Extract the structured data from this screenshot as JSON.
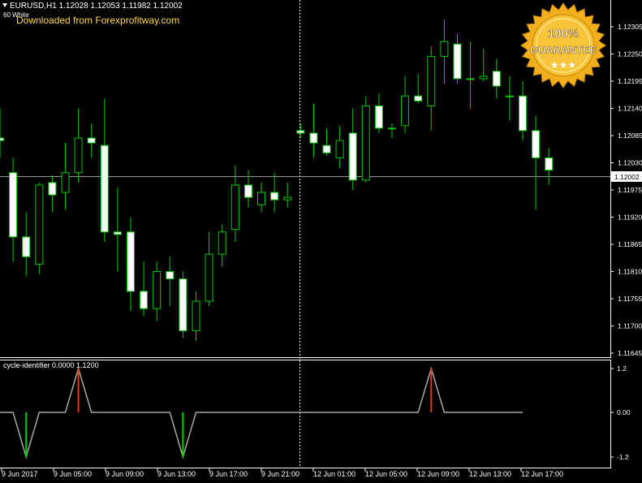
{
  "header": {
    "symbol_line": "EURUSD,H1  1.12028 1.12053 1.11982 1.12002",
    "template": "60 White",
    "download_note": "Downloaded from Forexprofitway.com"
  },
  "badge": {
    "line1": "100%",
    "line2": "GUARANTEE"
  },
  "colors": {
    "background": "#000000",
    "bull_wick": "#00c800",
    "bull_body": "#000000",
    "bear_body": "#ffffff",
    "axis": "#ffffff",
    "grid_line": "#9a9a9a",
    "indicator": "#a8a8a8",
    "peak_marker": "#d04020",
    "trough_marker": "#00d000",
    "badge_gold": "#f2b01e"
  },
  "price_axis": {
    "ticks": [
      "1.12305",
      "1.12250",
      "1.12195",
      "1.12140",
      "1.12085",
      "1.12030",
      "1.11975",
      "1.11920",
      "1.11865",
      "1.11810",
      "1.11755",
      "1.11700",
      "1.11645"
    ],
    "current_price": "1.12002"
  },
  "indicator": {
    "label": "cycle-identifier 0.0000 1.1200",
    "ticks": [
      "1.2",
      "0.00",
      "-1.2"
    ]
  },
  "time_axis": {
    "labels": [
      "9 Jun 2017",
      "9 Jun 05:00",
      "9 Jun 09:00",
      "9 Jun 13:00",
      "9 Jun 17:00",
      "9 Jun 21:00",
      "12 Jun 01:00",
      "12 Jun 05:00",
      "12 Jun 09:00",
      "12 Jun 13:00",
      "12 Jun 17:00"
    ]
  },
  "chart_data": {
    "type": "candlestick",
    "price_range": [
      1.11645,
      1.1235
    ],
    "candles": [
      {
        "o": 1.1208,
        "h": 1.1214,
        "l": 1.1204,
        "c": 1.12075
      },
      {
        "o": 1.1201,
        "h": 1.1204,
        "l": 1.1183,
        "c": 1.1188
      },
      {
        "o": 1.1188,
        "h": 1.1193,
        "l": 1.118,
        "c": 1.1184
      },
      {
        "o": 1.11825,
        "h": 1.1199,
        "l": 1.11805,
        "c": 1.11985
      },
      {
        "o": 1.1199,
        "h": 1.12005,
        "l": 1.1193,
        "c": 1.11965
      },
      {
        "o": 1.1197,
        "h": 1.1207,
        "l": 1.11935,
        "c": 1.1201
      },
      {
        "o": 1.1201,
        "h": 1.1214,
        "l": 1.1199,
        "c": 1.1208
      },
      {
        "o": 1.1208,
        "h": 1.1211,
        "l": 1.1204,
        "c": 1.1207
      },
      {
        "o": 1.12065,
        "h": 1.1216,
        "l": 1.1187,
        "c": 1.1189
      },
      {
        "o": 1.1189,
        "h": 1.1198,
        "l": 1.1181,
        "c": 1.11885
      },
      {
        "o": 1.1189,
        "h": 1.1192,
        "l": 1.1173,
        "c": 1.1177
      },
      {
        "o": 1.1177,
        "h": 1.1183,
        "l": 1.1172,
        "c": 1.11735
      },
      {
        "o": 1.11735,
        "h": 1.1183,
        "l": 1.1171,
        "c": 1.1181
      },
      {
        "o": 1.1181,
        "h": 1.1184,
        "l": 1.1174,
        "c": 1.11795
      },
      {
        "o": 1.11795,
        "h": 1.1181,
        "l": 1.11675,
        "c": 1.1169
      },
      {
        "o": 1.1169,
        "h": 1.1177,
        "l": 1.1167,
        "c": 1.1175
      },
      {
        "o": 1.1175,
        "h": 1.1189,
        "l": 1.1174,
        "c": 1.11845
      },
      {
        "o": 1.11845,
        "h": 1.11905,
        "l": 1.1182,
        "c": 1.1189
      },
      {
        "o": 1.11895,
        "h": 1.12025,
        "l": 1.1187,
        "c": 1.11985
      },
      {
        "o": 1.11985,
        "h": 1.12015,
        "l": 1.1194,
        "c": 1.1196
      },
      {
        "o": 1.11945,
        "h": 1.1199,
        "l": 1.1193,
        "c": 1.1197
      },
      {
        "o": 1.1197,
        "h": 1.1201,
        "l": 1.1193,
        "c": 1.11955
      },
      {
        "o": 1.11955,
        "h": 1.1199,
        "l": 1.1194,
        "c": 1.1196
      },
      {
        "o": 1.12095,
        "h": 1.1211,
        "l": 1.1208,
        "c": 1.1209
      },
      {
        "o": 1.1209,
        "h": 1.1215,
        "l": 1.1204,
        "c": 1.1207
      },
      {
        "o": 1.12065,
        "h": 1.121,
        "l": 1.12045,
        "c": 1.1205
      },
      {
        "o": 1.1204,
        "h": 1.12105,
        "l": 1.1202,
        "c": 1.12075
      },
      {
        "o": 1.1209,
        "h": 1.1214,
        "l": 1.11975,
        "c": 1.11995
      },
      {
        "o": 1.11995,
        "h": 1.12165,
        "l": 1.1199,
        "c": 1.12145
      },
      {
        "o": 1.12145,
        "h": 1.1217,
        "l": 1.1209,
        "c": 1.121
      },
      {
        "o": 1.121,
        "h": 1.1211,
        "l": 1.1208,
        "c": 1.121
      },
      {
        "o": 1.12105,
        "h": 1.12205,
        "l": 1.1209,
        "c": 1.12165
      },
      {
        "o": 1.12165,
        "h": 1.1221,
        "l": 1.1215,
        "c": 1.12155
      },
      {
        "o": 1.12145,
        "h": 1.12265,
        "l": 1.12095,
        "c": 1.12245
      },
      {
        "o": 1.12245,
        "h": 1.1232,
        "l": 1.1219,
        "c": 1.12275
      },
      {
        "o": 1.1227,
        "h": 1.1229,
        "l": 1.1219,
        "c": 1.122
      },
      {
        "o": 1.122,
        "h": 1.12275,
        "l": 1.1214,
        "c": 1.122
      },
      {
        "o": 1.122,
        "h": 1.1226,
        "l": 1.12195,
        "c": 1.12205
      },
      {
        "o": 1.12215,
        "h": 1.1224,
        "l": 1.1216,
        "c": 1.12185
      },
      {
        "o": 1.12165,
        "h": 1.12205,
        "l": 1.12115,
        "c": 1.12165
      },
      {
        "o": 1.12165,
        "h": 1.12195,
        "l": 1.12075,
        "c": 1.12095
      },
      {
        "o": 1.12095,
        "h": 1.12125,
        "l": 1.11935,
        "c": 1.1204
      },
      {
        "o": 1.1204,
        "h": 1.1206,
        "l": 1.11985,
        "c": 1.12015
      }
    ],
    "cycle_identifier": {
      "values": [
        0,
        0,
        -1.2,
        0,
        0,
        0,
        1.2,
        0,
        0,
        0,
        0,
        0,
        0,
        0,
        -1.2,
        0,
        0,
        0,
        0,
        0,
        0,
        0,
        0,
        0,
        0,
        0,
        0,
        0,
        0,
        0,
        0,
        0,
        0,
        1.2,
        0,
        0,
        0,
        0,
        0,
        0,
        0
      ],
      "ylim": [
        -1.2,
        1.2
      ]
    }
  }
}
